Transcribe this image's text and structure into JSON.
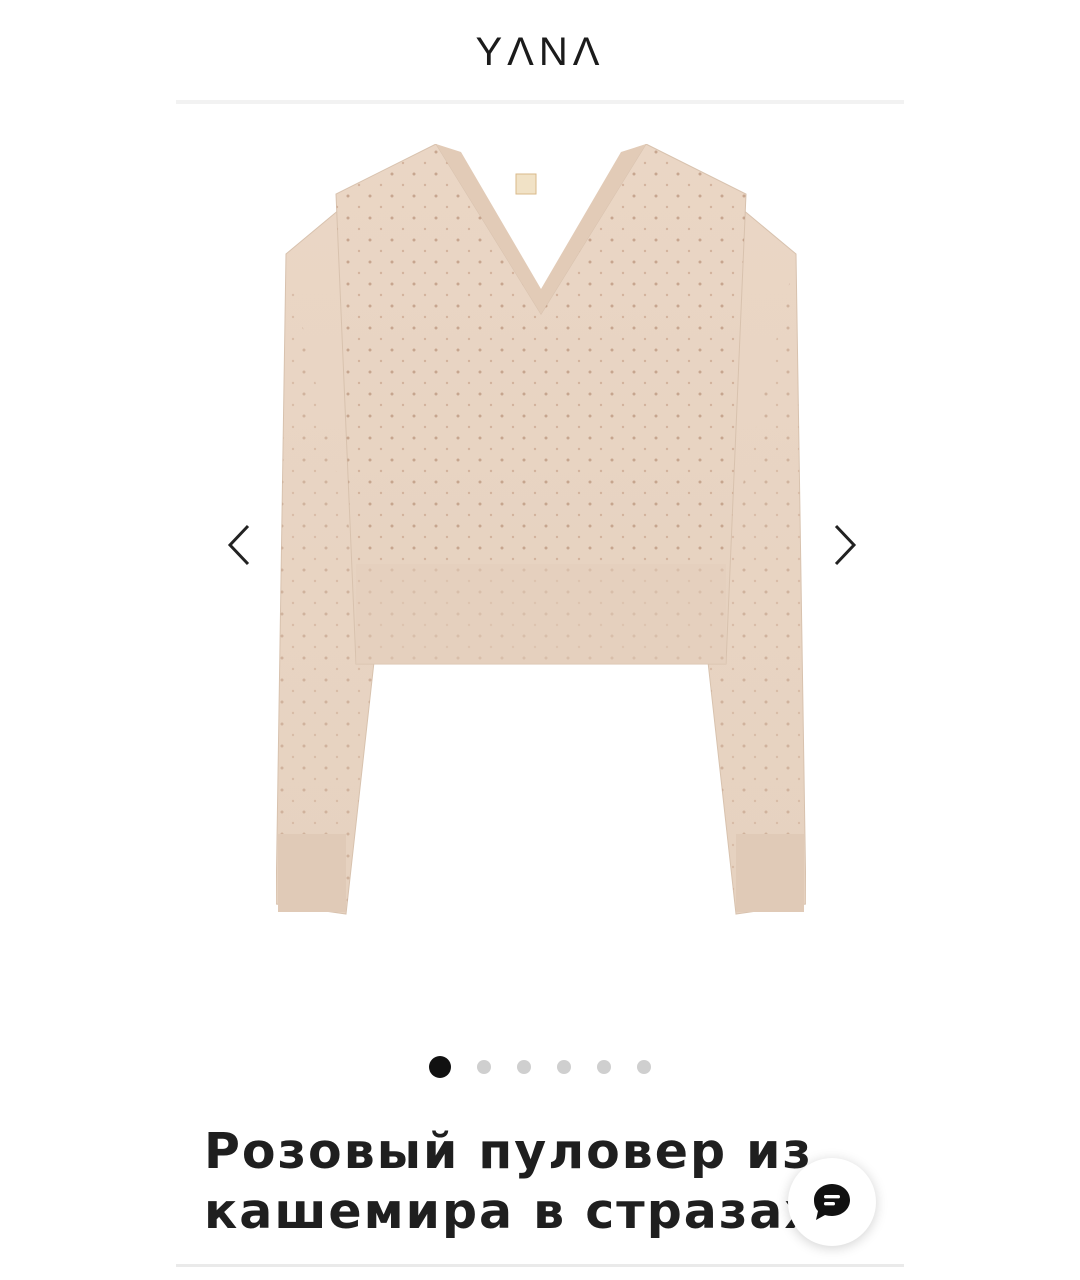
{
  "header": {
    "logo": "YΛNΛ"
  },
  "gallery": {
    "image_alt": "pink cashmere pullover with rhinestones",
    "prev_icon": "chevron-left-icon",
    "next_icon": "chevron-right-icon",
    "total_slides": 6,
    "active_slide": 1
  },
  "product": {
    "title_line1": "Розовый пуловер из",
    "title_line2": "кашемира в стразах"
  },
  "chat": {
    "icon": "chat-bubble-icon"
  },
  "colors": {
    "sweater": "#ecd9c8",
    "text": "#1f1f1f",
    "active_dot": "#111111",
    "inactive_dot": "#cfcfcf"
  }
}
